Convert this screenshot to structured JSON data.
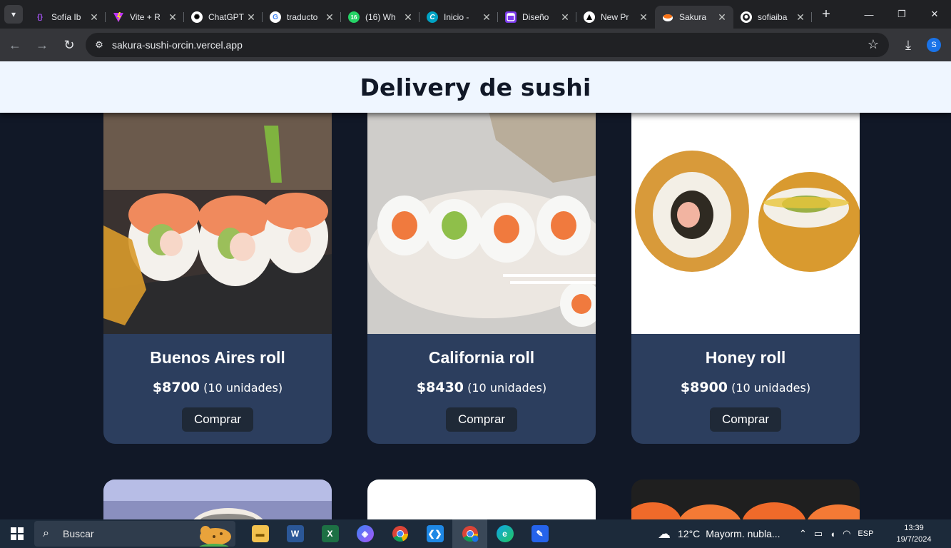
{
  "browser": {
    "tabs": [
      {
        "title": "Sofía Ib",
        "icon": "code-brackets-icon",
        "color": "#a855f7",
        "active": false
      },
      {
        "title": "Vite + R",
        "icon": "vite-icon",
        "color": "#bd34fe",
        "active": false
      },
      {
        "title": "ChatGPT",
        "icon": "chatgpt-icon",
        "color": "#ffffff",
        "active": false
      },
      {
        "title": "traducto",
        "icon": "google-icon",
        "color": "#4285f4",
        "active": false
      },
      {
        "title": "(16) Wh",
        "icon": "whatsapp-icon",
        "color": "#25d366",
        "badge": "16",
        "active": false
      },
      {
        "title": "Inicio -",
        "icon": "canva-icon",
        "color": "#00c4cc",
        "active": false
      },
      {
        "title": "Diseño",
        "icon": "design-icon",
        "color": "#7c3aed",
        "active": false
      },
      {
        "title": "New Pr",
        "icon": "vercel-icon",
        "color": "#000000",
        "active": false
      },
      {
        "title": "Sakura",
        "icon": "sushi-icon",
        "color": "#f97316",
        "active": true
      },
      {
        "title": "sofiaiba",
        "icon": "github-icon",
        "color": "#ffffff",
        "active": false
      }
    ],
    "url": "sakura-sushi-orcin.vercel.app",
    "profile_initial": "S"
  },
  "page": {
    "header_title": "Delivery de sushi",
    "products": [
      {
        "name": "Buenos Aires roll",
        "price": "$8700",
        "units": "(10 unidades)",
        "button": "Comprar",
        "image": "buenos-aires-roll-photo"
      },
      {
        "name": "California roll",
        "price": "$8430",
        "units": "(10 unidades)",
        "button": "Comprar",
        "image": "california-roll-photo"
      },
      {
        "name": "Honey roll",
        "price": "$8900",
        "units": "(10 unidades)",
        "button": "Comprar",
        "image": "honey-roll-photo"
      }
    ]
  },
  "taskbar": {
    "search_placeholder": "Buscar",
    "apps": [
      "file-explorer-icon",
      "word-icon",
      "excel-icon",
      "copilot-icon",
      "chrome-icon",
      "vscode-icon",
      "chrome-profile-icon",
      "edge-icon",
      "paint-icon"
    ],
    "weather_temp": "12°C",
    "weather_desc": "Mayorm. nubla...",
    "language": "ESP",
    "time": "13:39",
    "date": "19/7/2024"
  }
}
